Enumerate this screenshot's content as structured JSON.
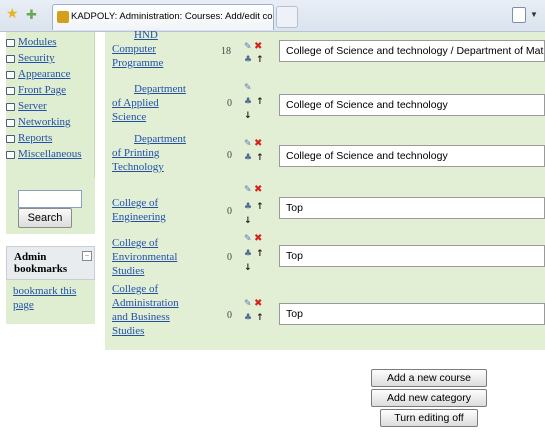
{
  "browser": {
    "tab_title": "KADPOLY: Administration: Courses: Add/edit co..."
  },
  "sidebar": {
    "items": [
      {
        "label": "Modules"
      },
      {
        "label": "Security"
      },
      {
        "label": "Appearance"
      },
      {
        "label": "Front Page"
      },
      {
        "label": "Server"
      },
      {
        "label": "Networking"
      },
      {
        "label": "Reports"
      },
      {
        "label": "Miscellaneous"
      }
    ],
    "search_button": "Search",
    "bookmarks_title": "Admin bookmarks",
    "bookmarks_link": "bookmark this page"
  },
  "categories": [
    {
      "name_lines": [
        "HND",
        "Computer",
        "Programme"
      ],
      "count": "18",
      "parent": "College of Science and technology / Department of Maths, Stat"
    },
    {
      "name_lines": [
        "Department",
        "of Applied",
        "Science"
      ],
      "count": "0",
      "parent": "College of Science and technology"
    },
    {
      "name_lines": [
        "Department",
        "of Printing",
        "Technology"
      ],
      "count": "0",
      "parent": "College of Science and technology"
    },
    {
      "name_lines": [
        "College of",
        "Engineering"
      ],
      "count": "0",
      "parent": "Top"
    },
    {
      "name_lines": [
        "College of",
        "Environmental",
        "Studies"
      ],
      "count": "0",
      "parent": "Top"
    },
    {
      "name_lines": [
        "College of",
        "Administration",
        "and Business",
        "Studies"
      ],
      "count": "0",
      "parent": "Top"
    }
  ],
  "icons": {
    "edit": "edit-icon",
    "delete": "delete-icon",
    "permissions": "permissions-icon",
    "move_up": "move-up-icon",
    "move_down": "move-down-icon"
  },
  "actions": {
    "add_course": "Add a new course",
    "add_category": "Add new category",
    "editing_off": "Turn editing off"
  }
}
